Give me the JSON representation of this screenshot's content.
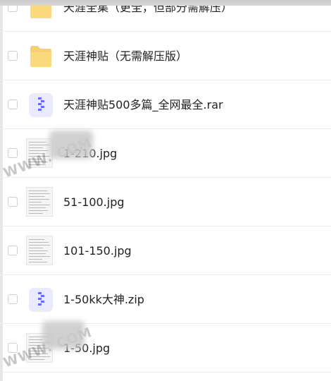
{
  "files": [
    {
      "name": "天涯全集（更全，但部分需解压）",
      "kind": "folder-icon"
    },
    {
      "name": "天涯神贴（无需解压版）",
      "kind": "folder-icon"
    },
    {
      "name": "天涯神贴500多篇_全网最全.rar",
      "kind": "archive-icon"
    },
    {
      "name": "1-210.jpg",
      "kind": "image-icon"
    },
    {
      "name": "51-100.jpg",
      "kind": "image-icon"
    },
    {
      "name": "101-150.jpg",
      "kind": "image-icon"
    },
    {
      "name": "1-50kk大神.zip",
      "kind": "archive-icon"
    },
    {
      "name": "1-50.jpg",
      "kind": "image-icon"
    }
  ],
  "watermark": {
    "text": "WWW.              COM"
  },
  "colors": {
    "folder": "#f8cf6f",
    "archive_bg": "#e9eafc",
    "archive_zip": "#6a6cf2",
    "divider": "#ececec"
  }
}
